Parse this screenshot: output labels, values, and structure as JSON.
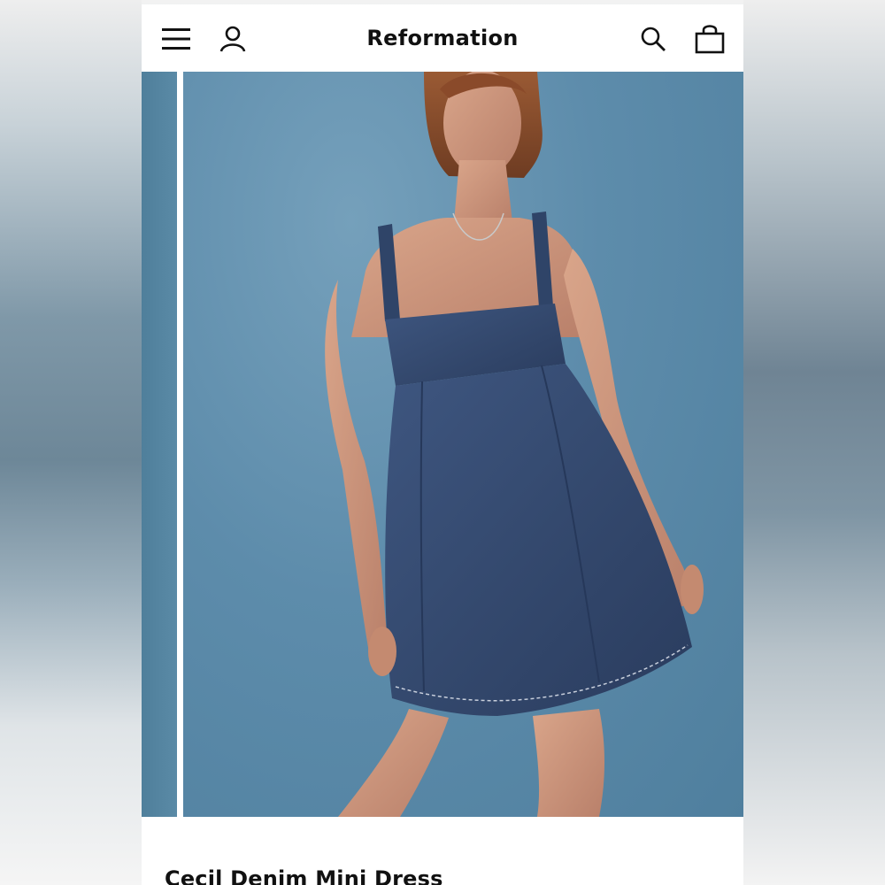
{
  "header": {
    "brand": "Reformation",
    "icons": [
      "menu-icon",
      "account-icon",
      "search-icon",
      "shopping-bag-icon"
    ]
  },
  "gallery": {
    "image_alt": "Model wearing a dark denim babydoll mini dress with square neckline and pleated skirt on a blue background"
  },
  "product": {
    "title": "Cecil Denim Mini Dress"
  },
  "colors": {
    "background": "#6a8fa8",
    "dress_denim": "#34496e",
    "header_text": "#111111"
  }
}
